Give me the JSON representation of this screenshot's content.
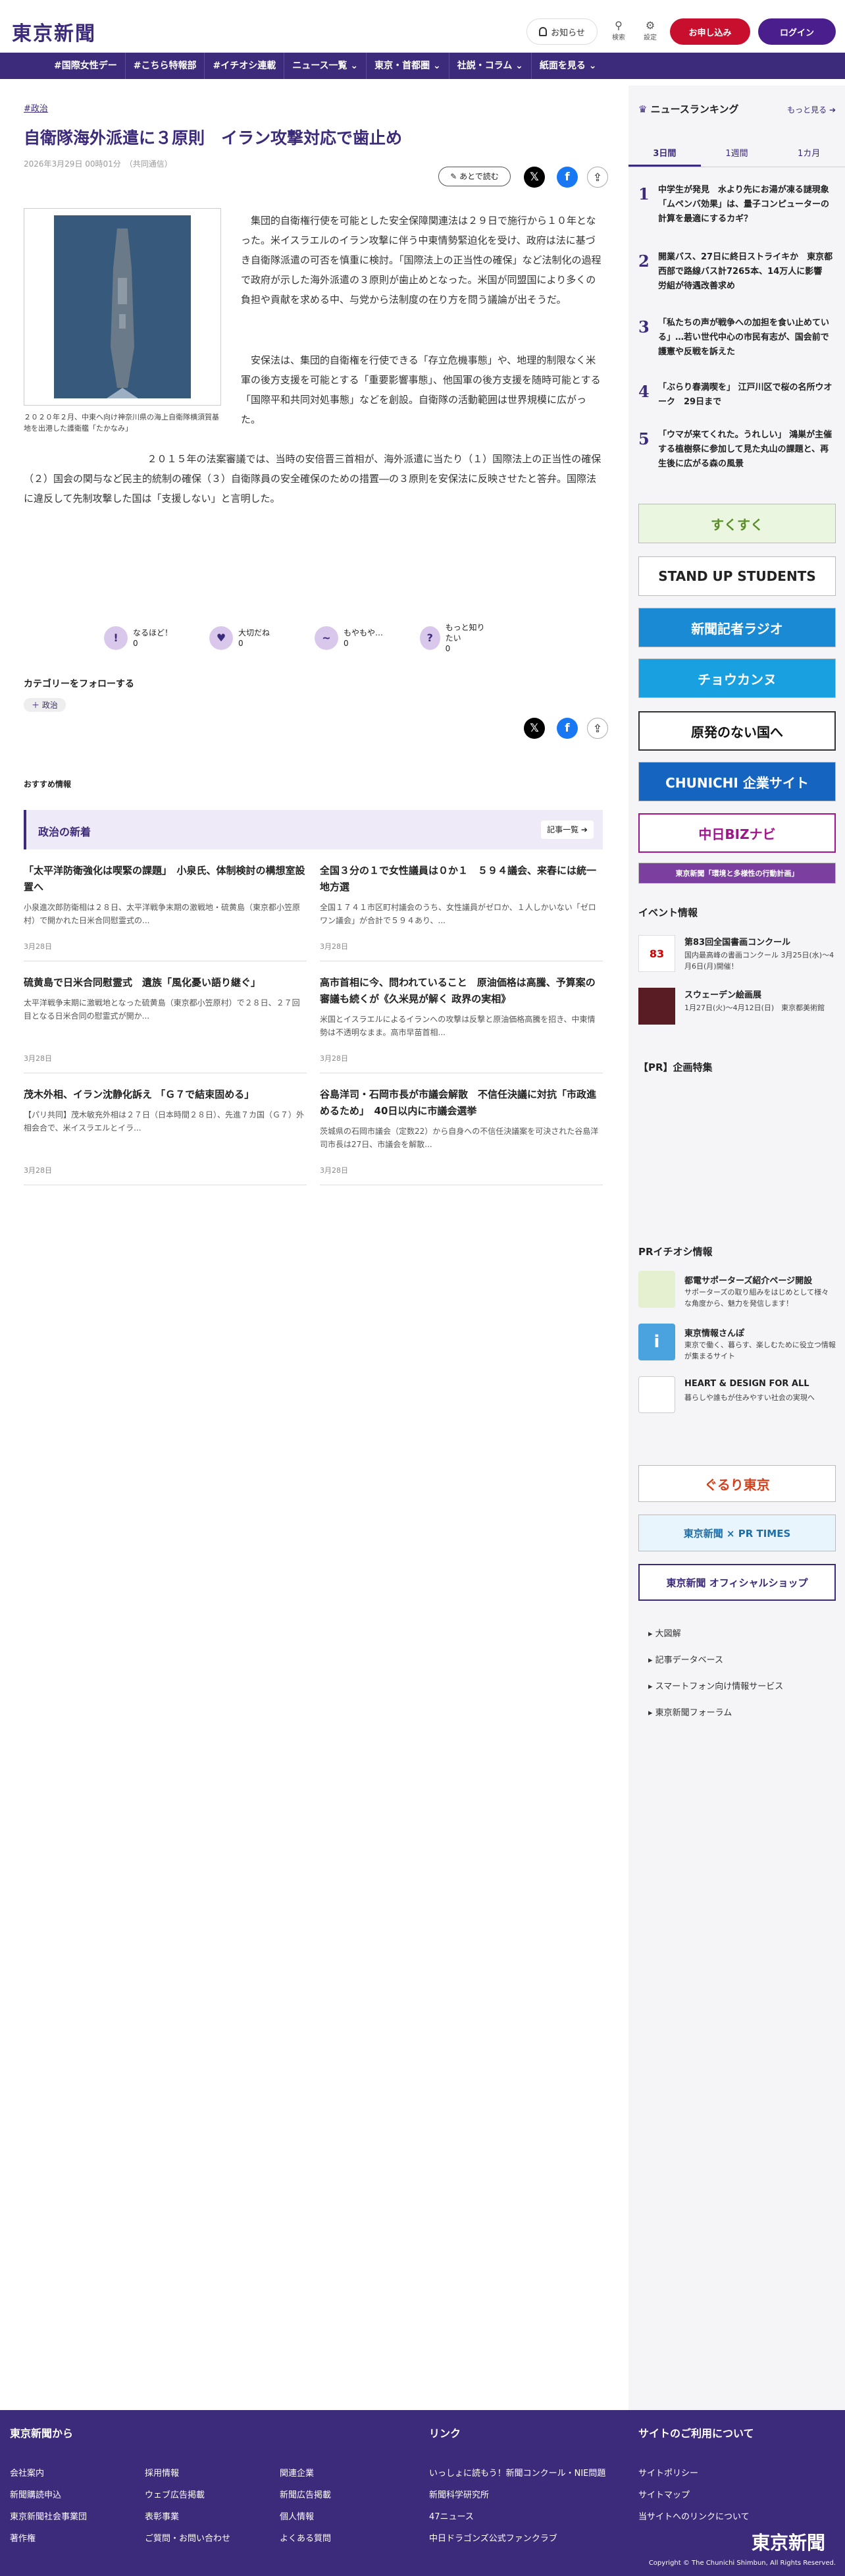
{
  "header": {
    "logo": "東京新聞",
    "notify": "お知らせ",
    "search": "検索",
    "settings": "設定",
    "subscribe": "お申し込み",
    "login": "ログイン"
  },
  "nav": [
    "#国際女性デー",
    "#こちら特報部",
    "#イチオシ連載",
    "ニュース一覧 ⌄",
    "東京・首都圏 ⌄",
    "社説・コラム ⌄",
    "紙面を見る ⌄"
  ],
  "article": {
    "category": "#政治",
    "title": "自衛隊海外派遣に３原則　イラン攻撃対応で歯止め",
    "date": "2026年3月29日 00時01分　（共同通信）",
    "read_later": "あとで読む",
    "caption": "２０２０年２月、中東へ向け神奈川県の海上自衛隊横須賀基地を出港した護衛艦「たかなみ」",
    "p1": "集団的自衛権行使を可能とした安全保障関連法は２９日で施行から１０年となった。米イスラエルのイラン攻撃に伴う中東情勢緊迫化を受け、政府は法に基づき自衛隊派遣の可否を慎重に検討。「国際法上の正当性の確保」など法制化の過程で政府が示した海外派遣の３原則が歯止めとなった。米国が同盟国により多くの負担や貢献を求める中、与党から法制度の在り方を問う議論が出そうだ。",
    "p2": "安保法は、集団的自衛権を行使できる「存立危機事態」や、地理的制限なく米軍の後方支援を可能とする「重要影響事態」、他国軍の後方支援を随時可能とする「国際平和共同対処事態」などを創設。自衛隊の活動範囲は世界規模に広がった。",
    "p3": "２０１５年の法案審議では、当時の安倍晋三首相が、海外派遣に当たり（１）国際法上の正当性の確保（２）国会の関与など民主的統制の確保（３）自衛隊員の安全確保のための措置―の３原則を安保法に反映させたと答弁。国際法に違反して先制攻撃した国は「支援しない」と言明した。"
  },
  "reactions": [
    {
      "label": "なるほど！",
      "count": "0",
      "icon": "!"
    },
    {
      "label": "大切だね",
      "count": "0",
      "icon": "♥"
    },
    {
      "label": "もやもや…",
      "count": "0",
      "icon": "~"
    },
    {
      "label": "もっと知りたい",
      "count": "0",
      "icon": "?"
    }
  ],
  "follow": {
    "heading": "カテゴリーをフォローする",
    "tag": "＋ 政治"
  },
  "recommend": "おすすめ情報",
  "news": {
    "heading": "政治の新着",
    "more": "記事一覧 ➔",
    "items": [
      {
        "title": "「太平洋防衛強化は喫緊の課題」　小泉氏、体制検討の構想室設置へ",
        "summary": "小泉進次郎防衛相は２８日、太平洋戦争末期の激戦地・硫黄島（東京都小笠原村）で開かれた日米合同慰霊式の...",
        "date": "3月28日"
      },
      {
        "title": "全国３分の１で女性議員は０か１　５９４議会、来春には統一地方選",
        "summary": "全国１７４１市区町村議会のうち、女性議員がゼロか、１人しかいない「ゼロワン議会」が合計で５９４あり、...",
        "date": "3月28日"
      },
      {
        "title": "硫黄島で日米合同慰霊式　遺族「風化憂い語り継ぐ」",
        "summary": "太平洋戦争末期に激戦地となった硫黄島（東京都小笠原村）で２８日、２７回目となる日米合同の慰霊式が開か...",
        "date": "3月28日"
      },
      {
        "title": "高市首相に今、問われていること　原油価格は高騰、予算案の審議も続くが《久米晃が解く 政界の実相》",
        "summary": "米国とイスラエルによるイランへの攻撃は反撃と原油価格高騰を招き、中東情勢は不透明なまま。高市早苗首相...",
        "date": "3月28日"
      },
      {
        "title": "茂木外相、イラン沈静化訴え 「Ｇ７で結束固める」",
        "summary": "【パリ共同】茂木敏充外相は２７日（日本時間２８日）、先進７カ国（Ｇ７）外相会合で、米イスラエルとイラ...",
        "date": "3月28日"
      },
      {
        "title": "谷島洋司・石岡市長が市議会解散　不信任決議に対抗「市政進めるため」　40日以内に市議会選挙",
        "summary": "茨城県の石岡市議会（定数22）から自身への不信任決議案を可決された谷島洋司市長は27日、市議会を解散...",
        "date": "3月28日"
      }
    ]
  },
  "ranking": {
    "heading": "ニュースランキング",
    "more": "もっと見る ➔",
    "tabs": [
      "3日間",
      "1週間",
      "1カ月"
    ],
    "items": [
      "中学生が発見　水より先にお湯が凍る謎現象「ムペンバ効果」は、量子コンピューターの計算を最適にするカギ？",
      "開業バス、27日に終日ストライキか　東京都西部で路線バス計7265本、14万人に影響　労組が待遇改善求め",
      "「私たちの声が戦争への加担を食い止めている」…若い世代中心の市民有志が、国会前で護憲や反戦を訴えた",
      "「ぶらり春満喫を」 江戸川区で桜の名所ウオーク　29日まで",
      "「ウマが来てくれた。うれしい」 鴻巣が主催する植樹祭に参加して見た丸山の課題と、再生後に広がる森の風景"
    ]
  },
  "banners": [
    "すくすく",
    "STAND UP STUDENTS",
    "新聞記者ラジオ",
    "チョウカンヌ",
    "原発のない国へ",
    "CHUNICHI 企業サイト",
    "中日BIZナビ",
    "東京新聞「環境と多様性の行動計画」"
  ],
  "events": {
    "heading": "イベント情報",
    "items": [
      {
        "title": "第83回全国書画コンクール",
        "sub": "国内最高峰の書画コンクール 3月25日(水)〜4月6日(月)開催！"
      },
      {
        "title": "スウェーデン絵画展",
        "sub": "1月27日(火)〜4月12日(日)　東京都美術館"
      }
    ]
  },
  "pr_heading": "【PR】企画特集",
  "pr_pick": {
    "heading": "PRイチオシ情報",
    "items": [
      {
        "title": "都電サポーターズ紹介ページ開設",
        "sub": "サポーターズの取り組みをはじめとして様々な角度から、魅力を発信します！"
      },
      {
        "title": "東京情報さんぽ",
        "sub": "東京で働く、暮らす、楽しむために役立つ情報が集まるサイト"
      },
      {
        "title": "HEART & DESIGN FOR ALL",
        "sub": "暮らしや誰もが住みやすい社会の実現へ"
      }
    ]
  },
  "side_banners": [
    "ぐるり東京",
    "東京新聞 × PR TIMES",
    "東京新聞 オフィシャルショップ"
  ],
  "side_links": [
    "大図解",
    "記事データベース",
    "スマートフォン向け情報サービス",
    "東京新聞フォーラム"
  ],
  "footer": {
    "col1_head": "東京新聞から",
    "col2_head": "リンク",
    "col3_head": "サイトのご利用について",
    "links1": [
      "会社案内",
      "採用情報",
      "関連企業",
      "新聞購読申込",
      "ウェブ広告掲載",
      "新聞広告掲載",
      "東京新聞社会事業団",
      "表彰事業",
      "個人情報",
      "著作権",
      "ご質問・お問い合わせ",
      "よくある質問"
    ],
    "links2": [
      "いっしょに読もう！新聞コンクール・NIE問題",
      "新聞科学研究所",
      "47ニュース",
      "中日ドラゴンズ公式ファンクラブ"
    ],
    "links3": [
      "サイトポリシー",
      "サイトマップ",
      "当サイトへのリンクについて"
    ],
    "logo": "東京新聞",
    "copyright": "Copyright © The Chunichi Shimbun, All Rights Reserved."
  }
}
